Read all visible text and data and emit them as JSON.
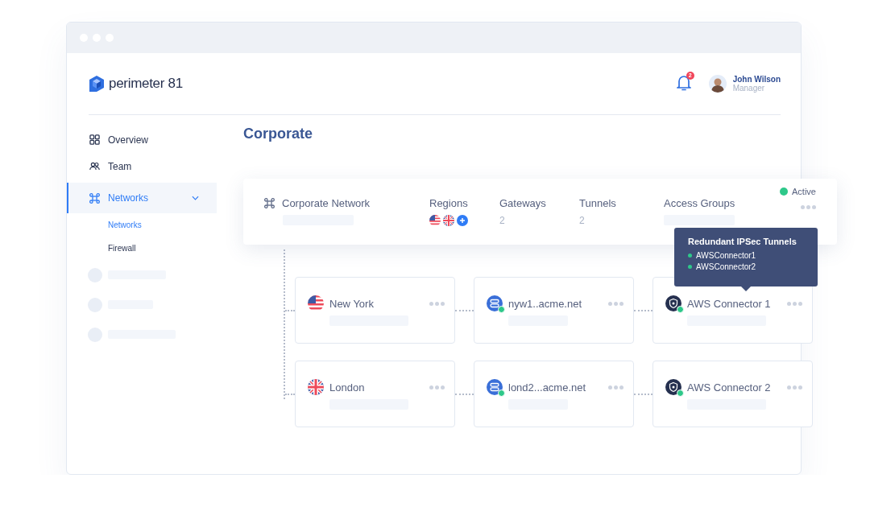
{
  "brand": {
    "name": "perimeter 81"
  },
  "notifications": {
    "count": "2"
  },
  "user": {
    "name": "John Wilson",
    "role": "Manager"
  },
  "sidebar": {
    "items": [
      {
        "kind": "overview",
        "label": "Overview",
        "selected": false
      },
      {
        "kind": "team",
        "label": "Team",
        "selected": false
      },
      {
        "kind": "networks",
        "label": "Networks",
        "selected": true,
        "expanded": true,
        "children": [
          {
            "label": "Networks",
            "selected": true
          },
          {
            "label": "Firewall",
            "selected": false
          }
        ]
      }
    ]
  },
  "page_title": "Corporate",
  "network": {
    "name": "Corporate Network",
    "status": {
      "label": "Active",
      "active": true
    },
    "columns": [
      {
        "kind": "regions",
        "label": "Regions",
        "flags": [
          {
            "kind": "us"
          },
          {
            "kind": "uk"
          }
        ]
      },
      {
        "kind": "value",
        "label": "Gateways",
        "value": "2"
      },
      {
        "kind": "value",
        "label": "Tunnels",
        "value": "2"
      },
      {
        "kind": "blank",
        "label": "Access Groups"
      }
    ]
  },
  "rows": [
    [
      {
        "kind": "region",
        "flag": {
          "kind": "us"
        },
        "name": "New York"
      },
      {
        "kind": "gateway",
        "name": "nyw1..acme.net",
        "online": true
      },
      {
        "kind": "connector",
        "name": "AWS Connector 1",
        "online": true
      }
    ],
    [
      {
        "kind": "region",
        "flag": {
          "kind": "uk"
        },
        "name": "London"
      },
      {
        "kind": "gateway",
        "name": "lond2...acme.net",
        "online": true
      },
      {
        "kind": "connector",
        "name": "AWS Connector 2",
        "online": true
      }
    ]
  ],
  "tooltip": {
    "title": "Redundant IPSec Tunnels",
    "items": [
      {
        "label": "AWSConnector1",
        "online": true
      },
      {
        "label": "AWSConnector2",
        "online": true
      }
    ]
  }
}
